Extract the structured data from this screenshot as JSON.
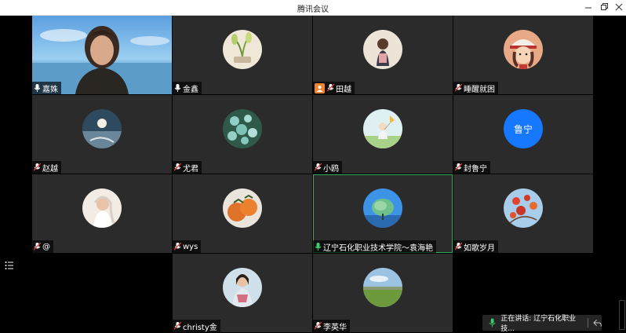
{
  "window": {
    "title": "腾讯会议"
  },
  "participants": [
    {
      "name": "嘉姝",
      "type": "video",
      "mic": "on"
    },
    {
      "name": "金鑫",
      "type": "avatar",
      "art": "plant",
      "mic": "on"
    },
    {
      "name": "田越",
      "type": "avatar",
      "art": "girl-back",
      "mic": "muted",
      "host": true
    },
    {
      "name": "睡醒就困",
      "type": "avatar",
      "art": "cartoon",
      "mic": "muted"
    },
    {
      "name": "赵越",
      "type": "avatar",
      "art": "moon",
      "mic": "muted"
    },
    {
      "name": "尤君",
      "type": "avatar",
      "art": "flowers",
      "mic": "muted"
    },
    {
      "name": "小鸥",
      "type": "avatar",
      "art": "girl-kite",
      "mic": "muted"
    },
    {
      "name": "封鲁宁",
      "type": "text",
      "avatar_text": "鲁宁",
      "mic": "muted"
    },
    {
      "name": "@",
      "type": "avatar",
      "art": "bride",
      "mic": "muted"
    },
    {
      "name": "wys",
      "type": "avatar",
      "art": "persimmon",
      "mic": "muted"
    },
    {
      "name": "辽宁石化职业技术学院～袁海艳",
      "type": "avatar",
      "art": "tree",
      "mic": "speaking",
      "active": true
    },
    {
      "name": "如歌岁月",
      "type": "avatar",
      "art": "autumn",
      "mic": "muted"
    },
    {
      "name": "christy金",
      "type": "avatar",
      "art": "woman",
      "mic": "muted"
    },
    {
      "name": "李英华",
      "type": "avatar",
      "art": "field",
      "mic": "muted"
    }
  ],
  "speaking_bar": {
    "text": "正在讲话: 辽宁石化职业技..."
  },
  "colors": {
    "tile": "#2b2b2b",
    "accent_green": "#2fae5c",
    "host_orange": "#f0832f",
    "avatar_blue": "#1677ff"
  }
}
